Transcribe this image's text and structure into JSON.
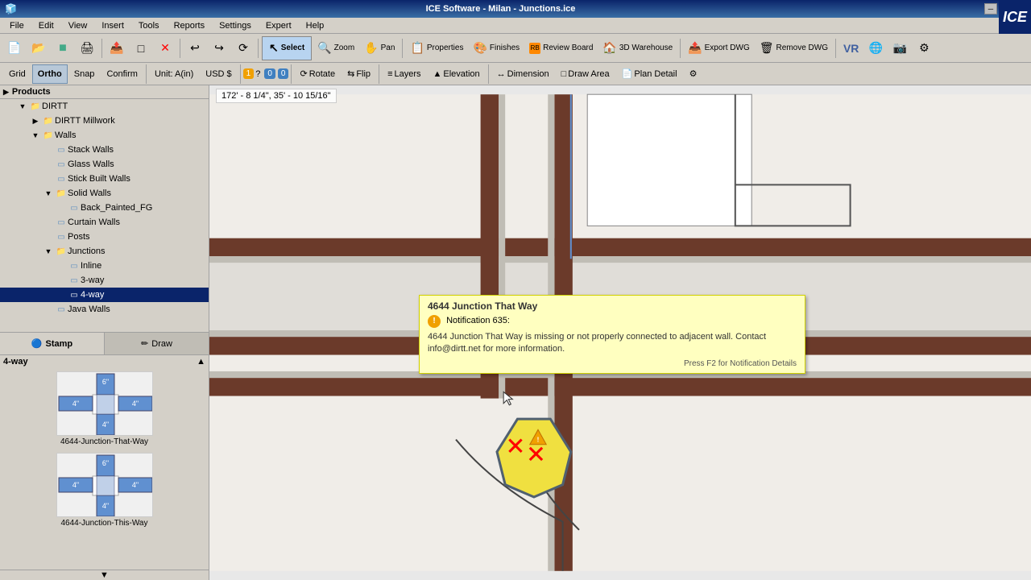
{
  "app": {
    "title": "ICE Software - Milan - Junctions.ice",
    "logo": "ICE",
    "coords": "172' - 8 1/4\", 35' - 10 15/16\""
  },
  "titlebar": {
    "minimize": "─",
    "maximize": "□",
    "close": "✕",
    "window_controls": [
      "─",
      "□",
      "✕"
    ]
  },
  "menu": {
    "items": [
      "File",
      "Edit",
      "View",
      "Insert",
      "Tools",
      "Reports",
      "Settings",
      "Expert",
      "Help"
    ]
  },
  "toolbar": {
    "buttons": [
      {
        "id": "new",
        "icon": "📄",
        "label": ""
      },
      {
        "id": "open",
        "icon": "📂",
        "label": ""
      },
      {
        "id": "save",
        "icon": "💾",
        "label": ""
      },
      {
        "id": "print",
        "icon": "🖨",
        "label": ""
      },
      {
        "id": "cut",
        "icon": "✂",
        "label": ""
      },
      {
        "id": "copy",
        "icon": "📋",
        "label": ""
      },
      {
        "id": "delete",
        "icon": "✕",
        "label": ""
      },
      {
        "id": "undo",
        "icon": "↩",
        "label": ""
      },
      {
        "id": "redo",
        "icon": "↪",
        "label": ""
      },
      {
        "id": "refresh",
        "icon": "⟳",
        "label": ""
      },
      {
        "id": "select",
        "icon": "↖",
        "label": "Select",
        "active": true
      },
      {
        "id": "zoom",
        "icon": "🔍",
        "label": "Zoom"
      },
      {
        "id": "pan",
        "icon": "✋",
        "label": "Pan"
      },
      {
        "id": "properties",
        "icon": "📋",
        "label": "Properties"
      },
      {
        "id": "finishes",
        "icon": "🎨",
        "label": "Finishes"
      },
      {
        "id": "review-board",
        "icon": "📊",
        "label": "Review Board"
      },
      {
        "id": "3d-warehouse",
        "icon": "🏠",
        "label": "3D Warehouse"
      },
      {
        "id": "export-dwg",
        "icon": "📤",
        "label": "Export DWG"
      },
      {
        "id": "remove-dwg",
        "icon": "🗑",
        "label": "Remove DWG"
      }
    ]
  },
  "tools_bar": {
    "grid": "Grid",
    "ortho": "Ortho",
    "snap": "Snap",
    "confirm": "Confirm",
    "unit": "Unit: A(in)",
    "currency": "USD $",
    "counter1": "0",
    "counter2": "0",
    "rotate": "Rotate",
    "flip": "Flip",
    "layers": "Layers",
    "elevation": "Elevation",
    "dimension": "Dimension",
    "draw_area": "Draw Area",
    "plan_detail": "Plan Detail",
    "num1": "1",
    "num2": "0",
    "num3": "0"
  },
  "tree": {
    "header": "Products",
    "items": [
      {
        "id": "dirtt-root",
        "label": "DIRTT",
        "indent": 1,
        "type": "folder",
        "expanded": true
      },
      {
        "id": "dirtt-millwork",
        "label": "DIRTT Millwork",
        "indent": 2,
        "type": "folder",
        "expanded": false
      },
      {
        "id": "walls",
        "label": "Walls",
        "indent": 2,
        "type": "folder",
        "expanded": true
      },
      {
        "id": "stack-walls",
        "label": "Stack Walls",
        "indent": 3,
        "type": "item"
      },
      {
        "id": "glass-walls",
        "label": "Glass Walls",
        "indent": 3,
        "type": "item"
      },
      {
        "id": "stick-built-walls",
        "label": "Stick Built Walls",
        "indent": 3,
        "type": "item"
      },
      {
        "id": "solid-walls",
        "label": "Solid Walls",
        "indent": 3,
        "type": "folder",
        "expanded": true
      },
      {
        "id": "back-painted-fg",
        "label": "Back_Painted_FG",
        "indent": 4,
        "type": "item"
      },
      {
        "id": "curtain-walls",
        "label": "Curtain Walls",
        "indent": 3,
        "type": "item"
      },
      {
        "id": "posts",
        "label": "Posts",
        "indent": 3,
        "type": "item"
      },
      {
        "id": "junctions",
        "label": "Junctions",
        "indent": 3,
        "type": "folder",
        "expanded": true
      },
      {
        "id": "inline",
        "label": "Inline",
        "indent": 4,
        "type": "item"
      },
      {
        "id": "3-way",
        "label": "3-way",
        "indent": 4,
        "type": "item"
      },
      {
        "id": "4-way",
        "label": "4-way",
        "indent": 4,
        "type": "item",
        "selected": true
      },
      {
        "id": "java-walls",
        "label": "Java Walls",
        "indent": 3,
        "type": "item"
      }
    ]
  },
  "stamp_panel": {
    "title": "4-way",
    "items": [
      {
        "id": "4644-junction-that-way",
        "label": "4644-Junction-That-Way",
        "dimensions": {
          "top": "6\"",
          "left": "4\"",
          "right": "4\"",
          "bottom": "4\""
        }
      },
      {
        "id": "4644-junction-this-way",
        "label": "4644-Junction-This-Way",
        "dimensions": {
          "top": "6\"",
          "left": "4\"",
          "right": "4\"",
          "bottom": "4\""
        }
      }
    ]
  },
  "tabs": {
    "stamp": "Stamp",
    "draw": "Draw"
  },
  "notification": {
    "title": "4644 Junction That Way",
    "icon": "!",
    "notification_num": "Notification 635:",
    "message": "4644 Junction That Way is missing or not properly connected to adjacent wall. Contact info@dirtt.net for more information.",
    "footer": "Press F2 for Notification Details"
  }
}
